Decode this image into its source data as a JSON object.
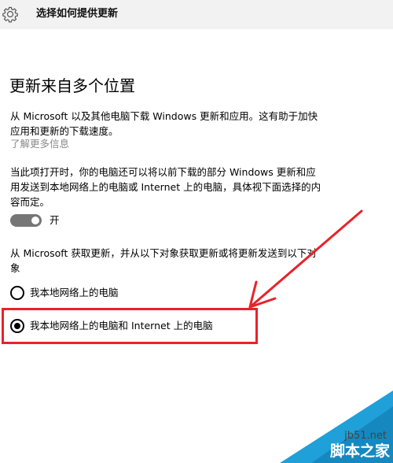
{
  "header": {
    "title": "选择如何提供更新",
    "icon": "gear-icon"
  },
  "section": {
    "title": "更新来自多个位置",
    "description": "从 Microsoft 以及其他电脑下载 Windows 更新和应用。这有助于加快应用和更新的下载速度。",
    "learn_more": "了解更多信息",
    "toggle_description": "当此项打开时，你的电脑还可以将以前下载的部分 Windows 更新和应用发送到本地网络上的电脑或 Internet 上的电脑，具体视下面选择的内容而定。",
    "toggle": {
      "state_label": "开",
      "on": true
    },
    "source_description": "从 Microsoft 获取更新，并从以下对象获取更新或将更新发送到以下对象",
    "options": [
      {
        "label": "我本地网络上的电脑",
        "selected": false
      },
      {
        "label": "我本地网络上的电脑和 Internet 上的电脑",
        "selected": true
      }
    ]
  },
  "watermark": {
    "site": "jb51.net",
    "name": "脚本之家"
  },
  "colors": {
    "header_bg": "#f2f2f2",
    "link": "#8a8a8a",
    "toggle_on": "#767676",
    "annotation": "#e8232a",
    "watermark_bg": "#1fa0d8"
  }
}
